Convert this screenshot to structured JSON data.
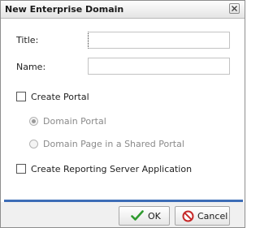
{
  "dialog": {
    "title": "New Enterprise Domain",
    "close_icon": "close-icon"
  },
  "form": {
    "title_label": "Title:",
    "title_value": "",
    "name_label": "Name:",
    "name_value": "",
    "create_portal_label": "Create Portal",
    "create_portal_checked": false,
    "domain_portal_label": "Domain Portal",
    "domain_portal_selected": true,
    "domain_page_shared_label": "Domain Page in a Shared Portal",
    "domain_page_shared_selected": false,
    "create_reporting_label": "Create Reporting Server Application",
    "create_reporting_checked": false
  },
  "buttons": {
    "ok_label": "OK",
    "ok_icon": "checkmark-icon",
    "cancel_label": "Cancel",
    "cancel_icon": "cancel-icon"
  },
  "colors": {
    "separator": "#3d6db6",
    "ok_icon": "#2e9a2e",
    "cancel_icon": "#c62828"
  }
}
